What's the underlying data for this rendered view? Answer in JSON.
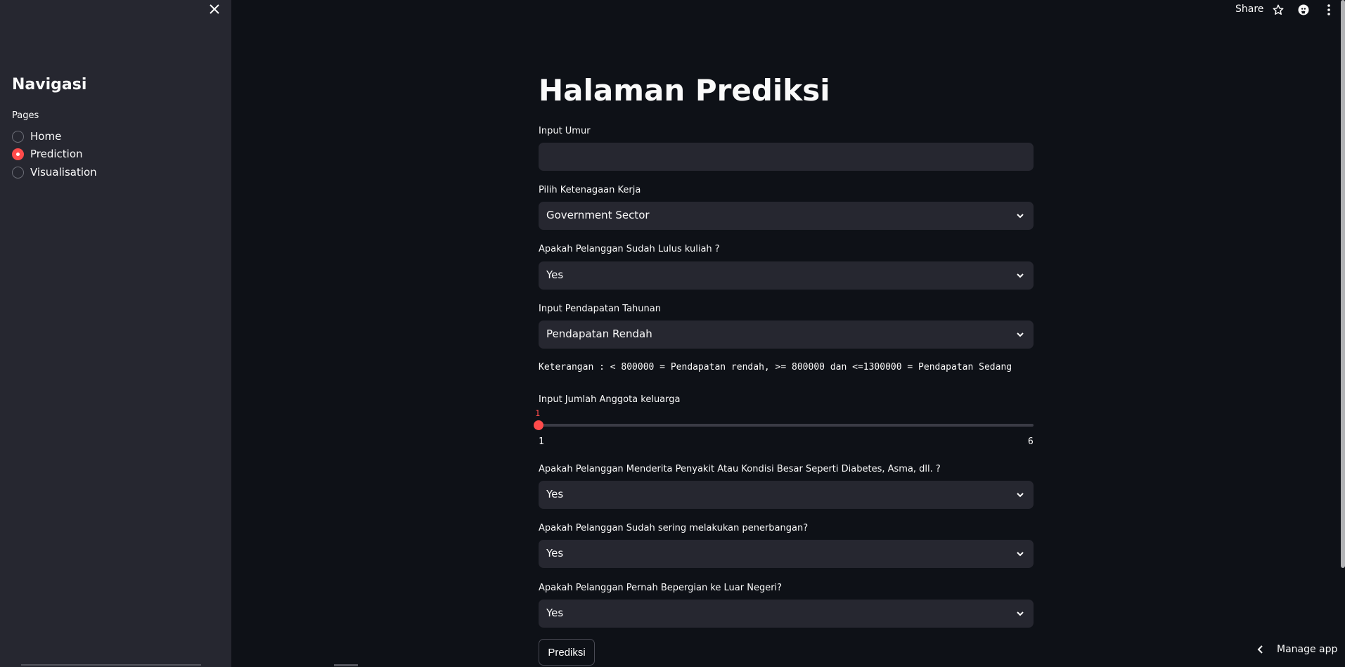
{
  "sidebar": {
    "title": "Navigasi",
    "pages_label": "Pages",
    "items": [
      {
        "label": "Home",
        "selected": false
      },
      {
        "label": "Prediction",
        "selected": true
      },
      {
        "label": "Visualisation",
        "selected": false
      }
    ]
  },
  "header": {
    "share_label": "Share",
    "icons": [
      "star-icon",
      "github-icon",
      "more-vertical-icon"
    ]
  },
  "main": {
    "title": "Halaman Prediksi",
    "age": {
      "label": "Input Umur",
      "value": ""
    },
    "employment": {
      "label": "Pilih Ketenagaan Kerja",
      "value": "Government Sector"
    },
    "graduated": {
      "label": "Apakah Pelanggan Sudah Lulus kuliah ?",
      "value": "Yes"
    },
    "income": {
      "label": "Input Pendapatan Tahunan",
      "value": "Pendapatan Rendah"
    },
    "note": "Keterangan : < 800000 = Pendapatan rendah, >= 800000 dan <=1300000 = Pendapatan Sedang",
    "family": {
      "label": "Input Jumlah Anggota keluarga",
      "value": "1",
      "min": "1",
      "max": "6"
    },
    "disease": {
      "label": "Apakah Pelanggan Menderita Penyakit Atau Kondisi Besar Seperti Diabetes, Asma, dll. ?",
      "value": "Yes"
    },
    "frequent_flyer": {
      "label": "Apakah Pelanggan Sudah sering melakukan penerbangan?",
      "value": "Yes"
    },
    "abroad": {
      "label": "Apakah Pelanggan Pernah Bepergian ke Luar Negeri?",
      "value": "Yes"
    },
    "submit_label": "Prediksi"
  },
  "footer": {
    "manage_label": "Manage app"
  },
  "colors": {
    "accent": "#ff4b4b",
    "background": "#0e1117",
    "sidebar": "#262730",
    "field": "#262730"
  }
}
